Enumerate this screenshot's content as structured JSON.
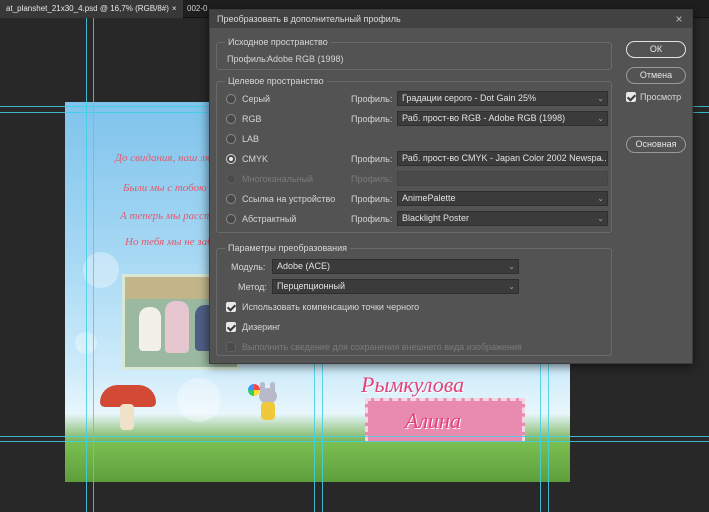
{
  "workspace": {
    "tabs": [
      {
        "label": "at_planshet_21x30_4.psd @ 16,7% (RGB/8#)",
        "close": "×"
      },
      {
        "label": "002-0"
      }
    ],
    "artwork": {
      "poem_lines": [
        "До свидания, наш любимый",
        "Были мы с тобою вместе",
        "А теперь мы расстаемся",
        "Но тебя мы не забудем з"
      ],
      "name_lines": [
        "Рымкулова",
        "Алина"
      ]
    }
  },
  "dialog": {
    "title": "Преобразовать в дополнительный профиль",
    "close": "×",
    "source": {
      "group_label": "Исходное пространство",
      "profile_label": "Профиль:",
      "profile_value": "Adobe RGB (1998)"
    },
    "target": {
      "group_label": "Целевое пространство",
      "rows": [
        {
          "label": "Серый",
          "profile_label": "Профиль:",
          "value": "Градации серого - Dot Gain 25%",
          "selected": false,
          "enabled": true
        },
        {
          "label": "RGB",
          "profile_label": "Профиль:",
          "value": "Раб. прост-во RGB - Adobe RGB (1998)",
          "selected": false,
          "enabled": true
        },
        {
          "label": "LAB",
          "selected": false,
          "enabled": true
        },
        {
          "label": "CMYK",
          "profile_label": "Профиль:",
          "value": "Раб. прост-во CMYK - Japan Color 2002 Newspa...",
          "selected": true,
          "enabled": true
        },
        {
          "label": "Многоканальный",
          "profile_label": "Профиль:",
          "value": "",
          "selected": false,
          "enabled": false
        },
        {
          "label": "Ссылка на устройство",
          "profile_label": "Профиль:",
          "value": "AnimePalette",
          "selected": false,
          "enabled": true
        },
        {
          "label": "Абстрактный",
          "profile_label": "Профиль:",
          "value": "Blacklight Poster",
          "selected": false,
          "enabled": true
        }
      ]
    },
    "conversion": {
      "group_label": "Параметры преобразования",
      "module_label": "Модуль:",
      "module_value": "Adobe (ACE)",
      "method_label": "Метод:",
      "method_value": "Перцепционный",
      "black_point_label": "Использовать компенсацию точки черного",
      "black_point_checked": true,
      "dither_label": "Дизеринг",
      "dither_checked": true,
      "flatten_label": "Выполнить сведение для сохранения внешнего вида изображения",
      "flatten_checked": false,
      "flatten_enabled": false
    },
    "buttons": {
      "ok": "ОК",
      "cancel": "Отмена",
      "preview_label": "Просмотр",
      "preview_checked": true,
      "basic": "Основная"
    },
    "chevron": "⌄"
  }
}
